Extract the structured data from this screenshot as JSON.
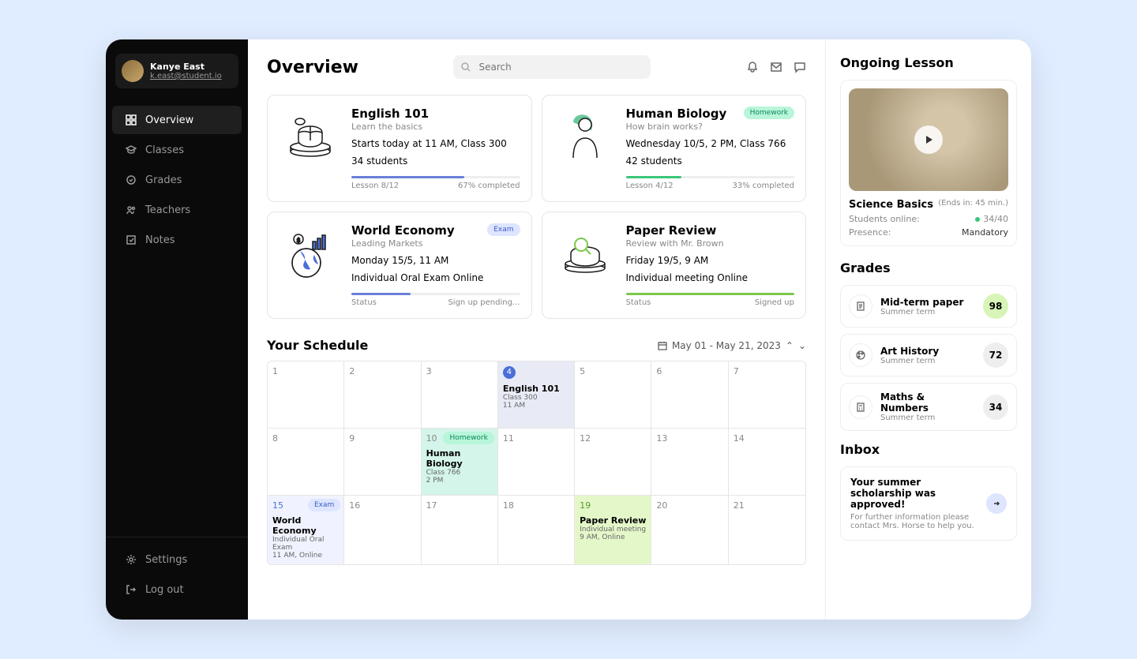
{
  "user": {
    "name": "Kanye East",
    "email": "k.east@student.io"
  },
  "nav": {
    "items": [
      {
        "label": "Overview",
        "icon": "grid"
      },
      {
        "label": "Classes",
        "icon": "cap"
      },
      {
        "label": "Grades",
        "icon": "check"
      },
      {
        "label": "Teachers",
        "icon": "people"
      },
      {
        "label": "Notes",
        "icon": "note"
      }
    ],
    "bottom": [
      {
        "label": "Settings",
        "icon": "gear"
      },
      {
        "label": "Log out",
        "icon": "logout"
      }
    ]
  },
  "header": {
    "title": "Overview",
    "search_placeholder": "Search"
  },
  "courses": [
    {
      "title": "English 101",
      "sub": "Learn the basics",
      "line1": "Starts today at 11 AM, Class 300",
      "line2": "34 students",
      "lesson": "Lesson 8/12",
      "completed": "67% completed",
      "progress_pct": 67,
      "color": "#6a7fd8",
      "badge": null
    },
    {
      "title": "Human Biology",
      "sub": "How brain works?",
      "line1": "Wednesday 10/5, 2 PM, Class 766",
      "line2": "42 students",
      "lesson": "Lesson 4/12",
      "completed": "33% completed",
      "progress_pct": 33,
      "color": "#3ac77a",
      "badge": {
        "text": "Homework",
        "cls": "hw"
      }
    },
    {
      "title": "World Economy",
      "sub": "Leading Markets",
      "line1": "Monday 15/5, 11 AM",
      "line2": "Individual Oral Exam Online",
      "lesson": "Status",
      "completed": "Sign up pending...",
      "progress_pct": 35,
      "color": "#6a7fd8",
      "badge": {
        "text": "Exam",
        "cls": "exam"
      }
    },
    {
      "title": "Paper Review",
      "sub": "Review with Mr. Brown",
      "line1": "Friday 19/5, 9 AM",
      "line2": "Individual meeting Online",
      "lesson": "Status",
      "completed": "Signed up",
      "progress_pct": 100,
      "color": "#7cc84a",
      "badge": null
    }
  ],
  "schedule": {
    "title": "Your Schedule",
    "range": "May 01 - May 21, 2023",
    "days": [
      "1",
      "2",
      "3",
      "4",
      "5",
      "6",
      "7",
      "8",
      "9",
      "10",
      "11",
      "12",
      "13",
      "14",
      "15",
      "16",
      "17",
      "18",
      "19",
      "20",
      "21"
    ],
    "events": {
      "4": {
        "title": "English 101",
        "sub1": "Class 300",
        "sub2": "11 AM",
        "circle": true
      },
      "10": {
        "title": "Human Biology",
        "sub1": "Class 766",
        "sub2": "2 PM",
        "badge": {
          "text": "Homework",
          "cls": "hw"
        }
      },
      "15": {
        "title": "World Economy",
        "sub1": "Individual Oral Exam",
        "sub2": "11 AM, Online",
        "badge": {
          "text": "Exam",
          "cls": "exam"
        }
      },
      "19": {
        "title": "Paper Review",
        "sub1": "Individual meeting",
        "sub2": "9 AM, Online"
      }
    }
  },
  "ongoing": {
    "heading": "Ongoing Lesson",
    "title": "Science Basics",
    "ends": "(Ends in: 45 min.)",
    "online_label": "Students online:",
    "online_value": "34/40",
    "presence_label": "Presence:",
    "presence_value": "Mandatory"
  },
  "grades": {
    "heading": "Grades",
    "items": [
      {
        "name": "Mid-term paper",
        "term": "Summer term",
        "score": "98",
        "bg": "#d8f5b8"
      },
      {
        "name": "Art History",
        "term": "Summer term",
        "score": "72",
        "bg": "#eee"
      },
      {
        "name": "Maths & Numbers",
        "term": "Summer term",
        "score": "34",
        "bg": "#eee"
      }
    ]
  },
  "inbox": {
    "heading": "Inbox",
    "title": "Your summer scholarship was approved!",
    "sub": "For further information please contact Mrs. Horse to help you."
  }
}
